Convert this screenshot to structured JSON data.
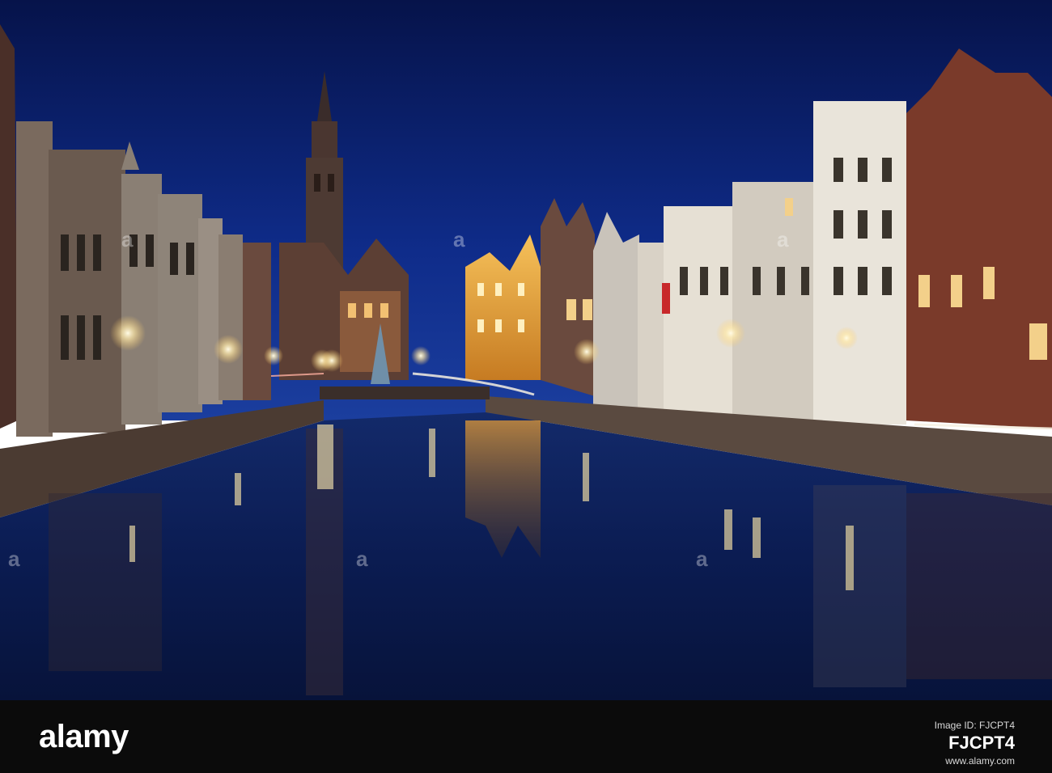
{
  "scene": {
    "subject": "night-canal-town-scene",
    "colors": {
      "sky_top": "#0a1f5c",
      "sky_bottom": "#1a3fa0",
      "water": "#0c1c4a",
      "lamp_glow": "#ffe9a8",
      "lit_facade": "#e8a23a"
    }
  },
  "watermark": {
    "brand": "alamy",
    "image_id_label": "Image ID: FJCPT4",
    "image_id": "FJCPT4",
    "website": "www.alamy.com"
  }
}
